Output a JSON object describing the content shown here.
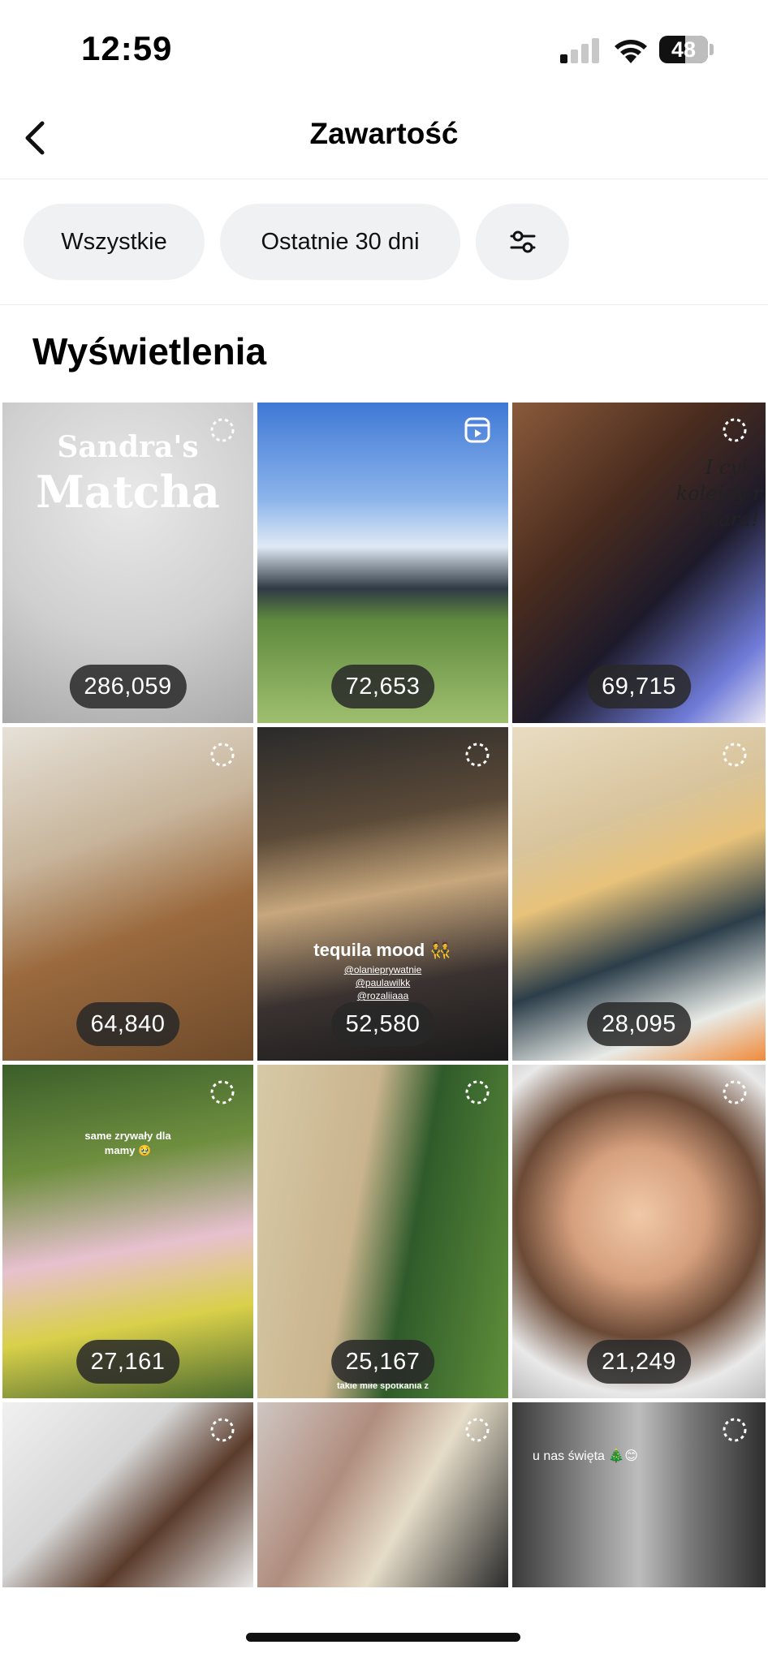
{
  "status_bar": {
    "time": "12:59",
    "battery": "48"
  },
  "header": {
    "title": "Zawartość"
  },
  "filters": {
    "all_label": "Wszystkie",
    "range_label": "Ostatnie 30 dni"
  },
  "section": {
    "title": "Wyświetlenia"
  },
  "posts": [
    {
      "views": "286,059",
      "kind": "post",
      "overlay": [
        "Sandra's",
        "Matcha"
      ]
    },
    {
      "views": "72,653",
      "kind": "reel",
      "overlay": []
    },
    {
      "views": "69,715",
      "kind": "post",
      "overlay": [
        "I cyk,",
        "kolejny r",
        "Stara!"
      ]
    },
    {
      "views": "64,840",
      "kind": "post",
      "overlay": []
    },
    {
      "views": "52,580",
      "kind": "post",
      "overlay": [
        "tequila mood 👯",
        "@olanieprywatnie",
        "@paulawilkk",
        "@rozaliiaaa"
      ]
    },
    {
      "views": "28,095",
      "kind": "post",
      "overlay": []
    },
    {
      "views": "27,161",
      "kind": "post",
      "overlay": [
        "same zrywały dla",
        "mamy 🥹"
      ]
    },
    {
      "views": "25,167",
      "kind": "post",
      "overlay": [
        "takie miłe spotkania z"
      ]
    },
    {
      "views": "21,249",
      "kind": "post",
      "overlay": []
    },
    {
      "views": "",
      "kind": "post",
      "overlay": []
    },
    {
      "views": "",
      "kind": "post",
      "overlay": []
    },
    {
      "views": "",
      "kind": "post",
      "overlay": [
        "u nas święta 🎄😊"
      ]
    }
  ],
  "colors": {
    "chip_bg": "#eff1f3",
    "badge_bg": "#282828"
  }
}
